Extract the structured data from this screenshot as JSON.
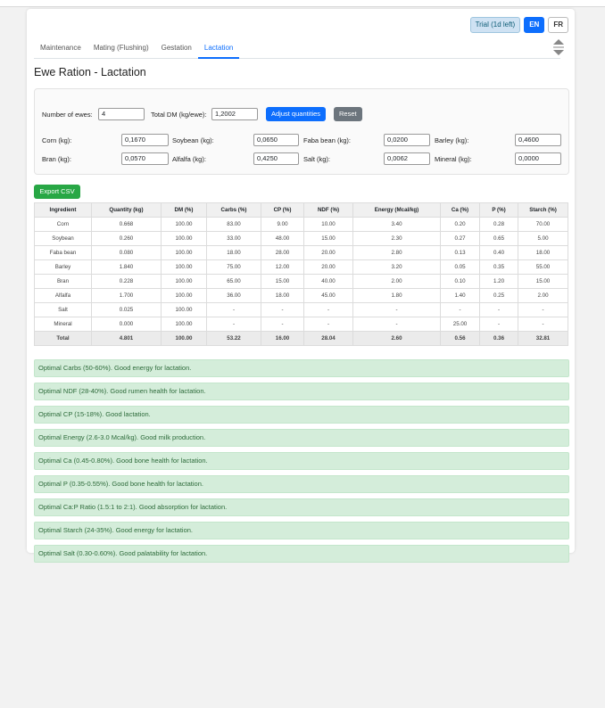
{
  "header": {
    "trial_badge": "Trial (1d left)",
    "lang_en": "EN",
    "lang_fr": "FR"
  },
  "tabs": [
    {
      "label": "Maintenance"
    },
    {
      "label": "Mating (Flushing)"
    },
    {
      "label": "Gestation"
    },
    {
      "label": "Lactation",
      "active": true
    }
  ],
  "page_title": "Ewe Ration - Lactation",
  "controls": {
    "ewes_label": "Number of ewes:",
    "ewes_value": "4",
    "total_dm_label": "Total DM (kg/ewe):",
    "total_dm_value": "1,2002",
    "adjust_label": "Adjust quantities",
    "reset_label": "Reset"
  },
  "inputs": [
    {
      "label": "Corn (kg):",
      "value": "0,1670"
    },
    {
      "label": "Soybean (kg):",
      "value": "0,0650"
    },
    {
      "label": "Faba bean (kg):",
      "value": "0,0200"
    },
    {
      "label": "Barley (kg):",
      "value": "0,4600"
    },
    {
      "label": "Bran (kg):",
      "value": "0,0570"
    },
    {
      "label": "Alfalfa (kg):",
      "value": "0,4250"
    },
    {
      "label": "Salt (kg):",
      "value": "0,0062"
    },
    {
      "label": "Mineral (kg):",
      "value": "0,0000"
    }
  ],
  "export_label": "Export CSV",
  "table": {
    "headers": [
      "Ingredient",
      "Quantity (kg)",
      "DM (%)",
      "Carbs (%)",
      "CP (%)",
      "NDF (%)",
      "Energy (Mcal/kg)",
      "Ca (%)",
      "P (%)",
      "Starch (%)"
    ],
    "rows": [
      [
        "Corn",
        "0.668",
        "100.00",
        "83.00",
        "9.00",
        "10.00",
        "3.40",
        "0.20",
        "0.28",
        "70.00"
      ],
      [
        "Soybean",
        "0.260",
        "100.00",
        "33.00",
        "48.00",
        "15.00",
        "2.30",
        "0.27",
        "0.65",
        "5.00"
      ],
      [
        "Faba bean",
        "0.080",
        "100.00",
        "18.00",
        "28.00",
        "20.00",
        "2.80",
        "0.13",
        "0.40",
        "18.00"
      ],
      [
        "Barley",
        "1.840",
        "100.00",
        "75.00",
        "12.00",
        "20.00",
        "3.20",
        "0.05",
        "0.35",
        "55.00"
      ],
      [
        "Bran",
        "0.228",
        "100.00",
        "65.00",
        "15.00",
        "40.00",
        "2.00",
        "0.10",
        "1.20",
        "15.00"
      ],
      [
        "Alfalfa",
        "1.700",
        "100.00",
        "36.00",
        "18.00",
        "45.00",
        "1.80",
        "1.40",
        "0.25",
        "2.00"
      ],
      [
        "Salt",
        "0.025",
        "100.00",
        "-",
        "-",
        "-",
        "-",
        "-",
        "-",
        "-"
      ],
      [
        "Mineral",
        "0.000",
        "100.00",
        "-",
        "-",
        "-",
        "-",
        "25.00",
        "-",
        "-"
      ]
    ],
    "total": [
      "Total",
      "4.801",
      "100.00",
      "53.22",
      "16.00",
      "28.04",
      "2.60",
      "0.56",
      "0.36",
      "32.81"
    ]
  },
  "alerts": [
    "Optimal Carbs (50-60%). Good energy for lactation.",
    "Optimal NDF (28-40%). Good rumen health for lactation.",
    "Optimal CP (15-18%). Good lactation.",
    "Optimal Energy (2.6-3.0 Mcal/kg). Good milk production.",
    "Optimal Ca (0.45-0.80%). Good bone health for lactation.",
    "Optimal P (0.35-0.55%). Good bone health for lactation.",
    "Optimal Ca:P Ratio (1.5:1 to 2:1). Good absorption for lactation.",
    "Optimal Starch (24-35%). Good energy for lactation.",
    "Optimal Salt (0.30-0.60%). Good palatability for lactation."
  ],
  "colors": {
    "primary": "#0d6efd",
    "success": "#28a745",
    "alert_bg": "#d4edda"
  }
}
